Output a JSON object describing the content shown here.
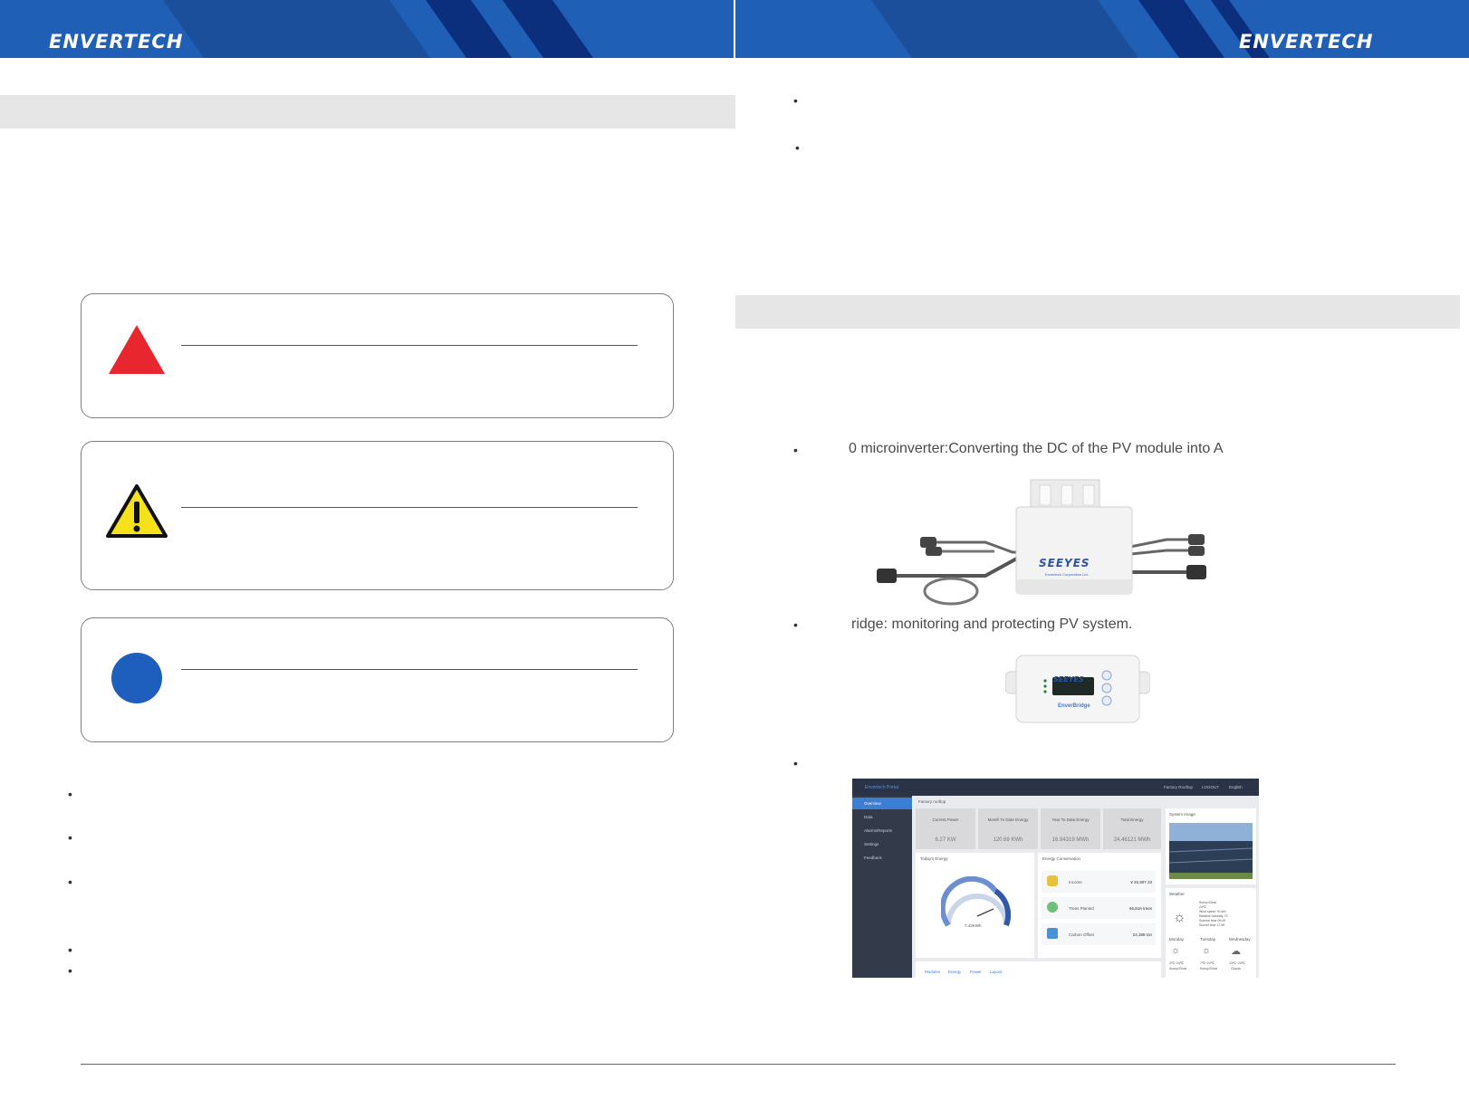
{
  "header": {
    "brand_left": "ENVERTECH",
    "brand_right": "ENVERTECH"
  },
  "colors": {
    "banner_blue": "#1f5fb6",
    "banner_dark": "#0c2f7d",
    "danger_red": "#e8262d",
    "warning_yellow": "#f6e21a",
    "info_blue": "#1e5ebd"
  },
  "right_column": {
    "component_1": "0 microinverter:Converting the DC of the PV module into A",
    "component_2": "ridge: monitoring and protecting PV system."
  },
  "inverter_image": {
    "brand": "SEEYES",
    "subtitle": "Envertech Corporation Ltd."
  },
  "bridge_image": {
    "brand": "SEEYES",
    "label": "EnverBridge"
  },
  "portal": {
    "logo_text": "Envertech Portal",
    "top_links": [
      "Factory Rooftop",
      "LOGOUT",
      "English"
    ],
    "nav": [
      "Overview",
      "Data",
      "Alarms/Reports",
      "Settings",
      "Feedback"
    ],
    "station": "Factory rooftop",
    "stats": [
      {
        "label": "Current Power",
        "value": "6.27 KW"
      },
      {
        "label": "Month To Date Energy",
        "value": "120.69 KWh"
      },
      {
        "label": "Year To Date Energy",
        "value": "16.94319 MWh"
      },
      {
        "label": "Total Energy",
        "value": "24.46121 MWh"
      }
    ],
    "today_title": "Today's Energy",
    "gauge_value": "7.42KWh",
    "conservation_title": "Energy Conservation",
    "conservation": [
      {
        "label": "Income",
        "value": "¥ 26,907.33"
      },
      {
        "label": "Trees Planted",
        "value": "66,816 trees"
      },
      {
        "label": "Carbon Offset",
        "value": "24,388 ton"
      }
    ],
    "system_image_title": "System Image",
    "weather_title": "Weather",
    "weather_now": [
      "Sunny/Clear",
      "24℃",
      "Wind speed 7Km/h",
      "Relative humidity 70",
      "Sunrise time 06:49",
      "Sunset time 17:59"
    ],
    "forecast": [
      {
        "day": "Monday",
        "temp": "3℃~24℃",
        "cond": "Sunny/Clear"
      },
      {
        "day": "Tuesday",
        "temp": "7℃~24℃",
        "cond": "Sunny/Clear"
      },
      {
        "day": "Wednesday",
        "temp": "13℃~24℃",
        "cond": "Clouds"
      }
    ],
    "bottom_tabs": [
      "Modules",
      "Energy",
      "Power",
      "Layout"
    ]
  }
}
